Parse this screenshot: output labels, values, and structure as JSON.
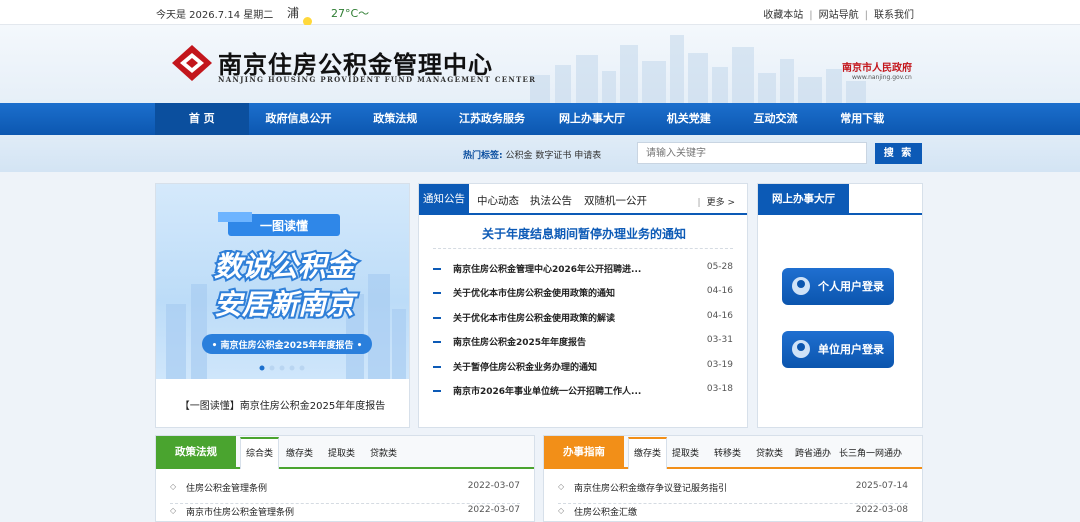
{
  "topbar": {
    "date": "今天是 2026.7.14 星期二",
    "city": "浦",
    "temp": "27°C～",
    "links": [
      "收藏本站",
      "网站导航",
      "联系我们"
    ],
    "separator": "|"
  },
  "header": {
    "title": "南京住房公积金管理中心",
    "subtitle": "NANJING HOUSING PROVIDENT FUND MANAGEMENT CENTER",
    "gov_title": "南京市人民政府",
    "gov_url": "www.nanjing.gov.cn"
  },
  "nav": {
    "items": [
      "首 页",
      "政府信息公开",
      "政策法规",
      "江苏政务服务",
      "网上办事大厅",
      "机关党建",
      "互动交流",
      "常用下载"
    ]
  },
  "search": {
    "hot_label": "热门标签:",
    "hot_tags": "公积金 数字证书 申请表",
    "placeholder": "请输入关键字",
    "button": "搜 索"
  },
  "banner": {
    "badge": "一图读懂",
    "line1": "数说公积金",
    "line2": "安居新南京",
    "ribbon": "• 南京住房公积金2025年年度报告 •",
    "caption": "【一图读懂】南京住房公积金2025年年度报告"
  },
  "news": {
    "tabs": [
      "通知公告",
      "中心动态",
      "执法公告",
      "双随机一公开"
    ],
    "more": "更多 >",
    "more_sep": "|",
    "headline": "关于年度结息期间暂停办理业务的通知",
    "items": [
      {
        "title": "南京住房公积金管理中心2026年公开招聘进...",
        "date": "05-28"
      },
      {
        "title": "关于优化本市住房公积金使用政策的通知",
        "date": "04-16"
      },
      {
        "title": "关于优化本市住房公积金使用政策的解读",
        "date": "04-16"
      },
      {
        "title": "南京住房公积金2025年年度报告",
        "date": "03-31"
      },
      {
        "title": "关于暂停住房公积金业务办理的通知",
        "date": "03-19"
      },
      {
        "title": "南京市2026年事业单位统一公开招聘工作人...",
        "date": "03-18"
      }
    ]
  },
  "hall": {
    "title": "网上办事大厅",
    "personal": "个人用户登录",
    "company": "单位用户登录"
  },
  "policy": {
    "label": "政策法规",
    "tabs": [
      "综合类",
      "缴存类",
      "提取类",
      "贷款类"
    ],
    "items": [
      {
        "title": "住房公积金管理条例",
        "date": "2022-03-07"
      },
      {
        "title": "南京市住房公积金管理条例",
        "date": "2022-03-07"
      }
    ]
  },
  "guide": {
    "label": "办事指南",
    "tabs": [
      "缴存类",
      "提取类",
      "转移类",
      "贷款类",
      "跨省通办",
      "长三角一网通办"
    ],
    "items": [
      {
        "title": "南京住房公积金缴存争议登记服务指引",
        "date": "2025-07-14"
      },
      {
        "title": "住房公积金汇缴",
        "date": "2022-03-08"
      }
    ]
  },
  "colors": {
    "primary": "#0c5ab6",
    "green": "#4aa42f",
    "orange": "#f28f18",
    "logo_red": "#c3161c"
  }
}
